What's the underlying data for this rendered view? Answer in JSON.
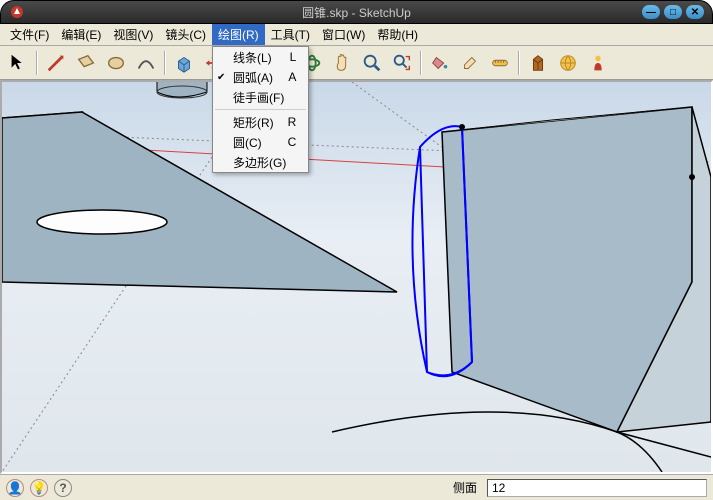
{
  "window": {
    "title": "圆锥.skp - SketchUp"
  },
  "menu": {
    "file": "文件(F)",
    "edit": "编辑(E)",
    "view": "视图(V)",
    "camera": "镜头(C)",
    "draw": "绘图(R)",
    "tools": "工具(T)",
    "window": "窗口(W)",
    "help": "帮助(H)"
  },
  "dropdown": {
    "line": {
      "label": "线条(L)",
      "shortcut": "L"
    },
    "arc": {
      "label": "圆弧(A)",
      "shortcut": "A"
    },
    "freehand": {
      "label": "徒手画(F)",
      "shortcut": ""
    },
    "rect": {
      "label": "矩形(R)",
      "shortcut": "R"
    },
    "circle": {
      "label": "圆(C)",
      "shortcut": "C"
    },
    "polygon": {
      "label": "多边形(G)",
      "shortcut": ""
    }
  },
  "status": {
    "label": "侧面",
    "value": "12"
  }
}
